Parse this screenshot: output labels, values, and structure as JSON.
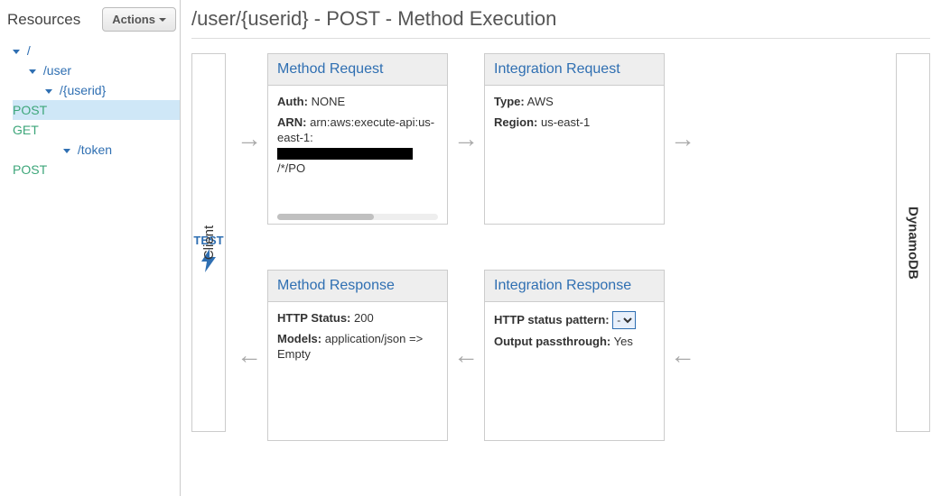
{
  "sidebar": {
    "title": "Resources",
    "actions_label": "Actions",
    "tree": {
      "root": "/",
      "user": "/user",
      "userid": "/{userid}",
      "userid_post": "POST",
      "userid_get": "GET",
      "token": "/token",
      "token_post": "POST"
    }
  },
  "page": {
    "title": "/user/{userid} - POST - Method Execution"
  },
  "client_box": {
    "test_label": "TEST",
    "vertical_label": "Client"
  },
  "target_box": {
    "vertical_label": "DynamoDB"
  },
  "panels": {
    "method_request": {
      "title": "Method Request",
      "auth_label": "Auth:",
      "auth_value": "NONE",
      "arn_label": "ARN:",
      "arn_prefix": "arn:aws:execute-api:us-east-1:",
      "arn_suffix": "/*/PO"
    },
    "integration_request": {
      "title": "Integration Request",
      "type_label": "Type:",
      "type_value": "AWS",
      "region_label": "Region:",
      "region_value": "us-east-1"
    },
    "method_response": {
      "title": "Method Response",
      "status_label": "HTTP Status:",
      "status_value": "200",
      "models_label": "Models:",
      "models_value": "application/json => Empty"
    },
    "integration_response": {
      "title": "Integration Response",
      "pattern_label": "HTTP status pattern:",
      "pattern_value": "-",
      "passthrough_label": "Output passthrough:",
      "passthrough_value": "Yes"
    }
  }
}
